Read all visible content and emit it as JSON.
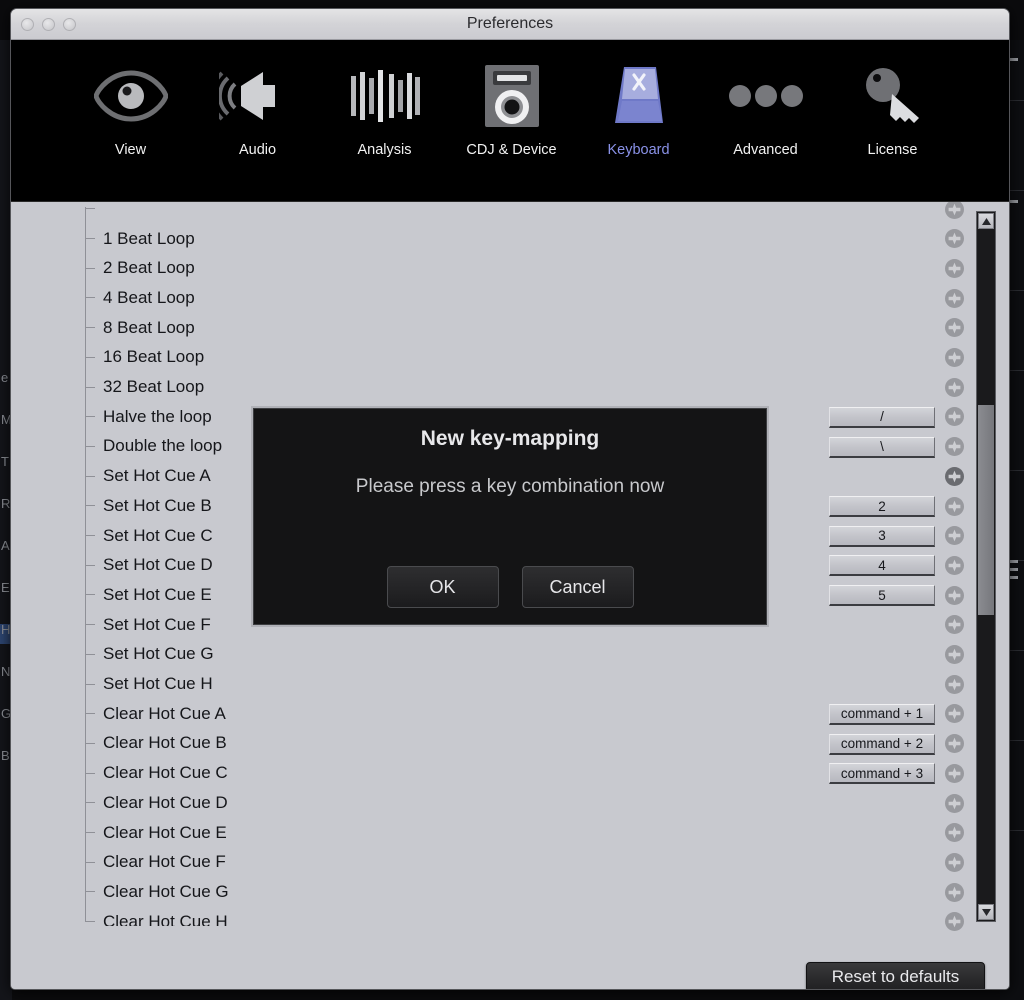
{
  "window": {
    "title": "Preferences",
    "traffic_lights": [
      "close-button",
      "minimize-button",
      "zoom-button"
    ]
  },
  "toolbar": {
    "items": [
      {
        "label": "View",
        "icon": "eye-icon",
        "active": false
      },
      {
        "label": "Audio",
        "icon": "speaker-icon",
        "active": false
      },
      {
        "label": "Analysis",
        "icon": "waveform-icon",
        "active": false
      },
      {
        "label": "CDJ & Device",
        "icon": "cdj-device-icon",
        "active": false
      },
      {
        "label": "Keyboard",
        "icon": "keycap-icon",
        "active": true
      },
      {
        "label": "Advanced",
        "icon": "ellipsis-icon",
        "active": false
      },
      {
        "label": "License",
        "icon": "key-icon",
        "active": false
      }
    ],
    "active_color": "#8a92e8",
    "background": "#000000"
  },
  "list": {
    "rows": [
      {
        "label": "",
        "clipped": true,
        "mapping": "",
        "plus": true
      },
      {
        "label": "1 Beat Loop",
        "clipped": false,
        "mapping": "",
        "plus": true
      },
      {
        "label": "2 Beat Loop",
        "clipped": false,
        "mapping": "",
        "plus": true
      },
      {
        "label": "4 Beat Loop",
        "clipped": false,
        "mapping": "",
        "plus": true
      },
      {
        "label": "8 Beat Loop",
        "clipped": false,
        "mapping": "",
        "plus": true
      },
      {
        "label": "16 Beat Loop",
        "clipped": false,
        "mapping": "",
        "plus": true
      },
      {
        "label": "32 Beat Loop",
        "clipped": false,
        "mapping": "",
        "plus": true
      },
      {
        "label": "Halve the loop",
        "clipped": false,
        "mapping": "/",
        "plus": true
      },
      {
        "label": "Double the loop",
        "clipped": false,
        "mapping": "\\",
        "plus": true
      },
      {
        "label": "Set Hot Cue A",
        "clipped": false,
        "mapping": "",
        "plus": true
      },
      {
        "label": "Set Hot Cue B",
        "clipped": false,
        "mapping": "2",
        "plus": true
      },
      {
        "label": "Set Hot Cue C",
        "clipped": false,
        "mapping": "3",
        "plus": true
      },
      {
        "label": "Set Hot Cue D",
        "clipped": false,
        "mapping": "4",
        "plus": true
      },
      {
        "label": "Set Hot Cue E",
        "clipped": false,
        "mapping": "5",
        "plus": true
      },
      {
        "label": "Set Hot Cue F",
        "clipped": false,
        "mapping": "",
        "plus": true
      },
      {
        "label": "Set Hot Cue G",
        "clipped": false,
        "mapping": "",
        "plus": true
      },
      {
        "label": "Set Hot Cue H",
        "clipped": false,
        "mapping": "",
        "plus": true
      },
      {
        "label": "Clear Hot Cue A",
        "clipped": false,
        "mapping": "command + 1",
        "plus": true
      },
      {
        "label": "Clear Hot Cue B",
        "clipped": false,
        "mapping": "command + 2",
        "plus": true
      },
      {
        "label": "Clear Hot Cue C",
        "clipped": false,
        "mapping": "command + 3",
        "plus": true
      },
      {
        "label": "Clear Hot Cue D",
        "clipped": false,
        "mapping": "",
        "plus": true
      },
      {
        "label": "Clear Hot Cue E",
        "clipped": false,
        "mapping": "",
        "plus": true
      },
      {
        "label": "Clear Hot Cue F",
        "clipped": false,
        "mapping": "",
        "plus": true
      },
      {
        "label": "Clear Hot Cue G",
        "clipped": false,
        "mapping": "",
        "plus": true
      },
      {
        "label": "Clear Hot Cue H",
        "clipped": false,
        "mapping": "",
        "plus": true
      }
    ]
  },
  "scrollbar": {
    "up_arrow": "scroll-up-arrow",
    "down_arrow": "scroll-down-arrow",
    "thumb_top_pct": 26,
    "thumb_height_pct": 31
  },
  "footer": {
    "reset_label": "Reset to defaults"
  },
  "modal": {
    "title": "New key-mapping",
    "message": "Please press a key combination now",
    "ok_label": "OK",
    "cancel_label": "Cancel"
  },
  "colors": {
    "pane_bg": "#c8c9cf",
    "toolbar_bg": "#000000",
    "accent": "#8a92e8",
    "modal_bg": "#141415",
    "key_button": "#c3c4ca"
  }
}
